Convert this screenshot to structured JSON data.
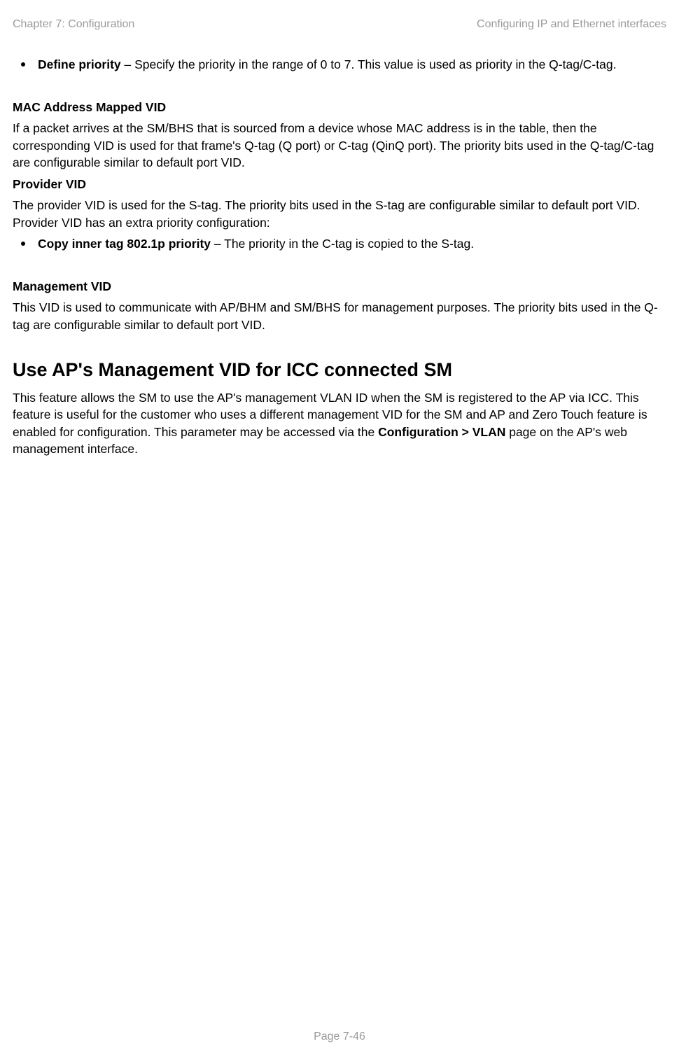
{
  "header": {
    "left": "Chapter 7:  Configuration",
    "right": "Configuring IP and Ethernet interfaces"
  },
  "bullet1": {
    "lead": "Define priority",
    "text": " – Specify the priority in the range of 0 to 7. This value is used as priority in the Q-tag/C-tag."
  },
  "mac": {
    "title": "MAC Address Mapped VID",
    "para": "If a packet arrives at the SM/BHS that is sourced from a device whose MAC address is in the table, then the corresponding VID is used for that frame's Q-tag (Q port) or C-tag (QinQ port). The priority bits used in the Q-tag/C-tag are configurable similar to default port VID."
  },
  "provider": {
    "title": "Provider VID",
    "para": "The provider VID is used for the S-tag. The priority bits used in the S-tag are configurable similar to default port VID. Provider VID has an extra priority configuration:",
    "bullet_lead": "Copy inner tag 802.1p priority",
    "bullet_text": " – The priority in the C-tag is copied to the S-tag."
  },
  "mgmt": {
    "title": "Management VID",
    "para": "This VID is used to communicate with AP/BHM and SM/BHS for management purposes. The priority bits used in the Q-tag are configurable similar to default port VID."
  },
  "section": {
    "title": "Use AP's Management VID for ICC connected SM",
    "p1a": "This feature allows the SM to use the AP's management VLAN ID when the SM is registered to the AP via ICC. This feature is useful for the customer who uses a different management VID for the SM and AP and Zero Touch feature is enabled for configuration. This parameter may be accessed via the ",
    "p1b": "Configuration > VLAN",
    "p1c": " page on the AP's web management interface."
  },
  "footer": "Page 7-46"
}
